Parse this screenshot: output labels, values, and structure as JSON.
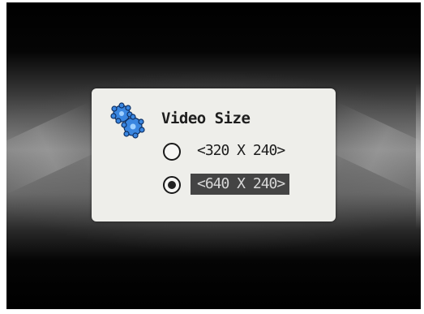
{
  "dialog": {
    "title": "Video Size",
    "options": [
      {
        "label": "<320 X 240>",
        "selected": false
      },
      {
        "label": "<640 X 240>",
        "selected": true
      }
    ]
  },
  "icons": {
    "settings": "gear-cluster-icon"
  },
  "colors": {
    "dialog_background": "#eeeeea",
    "icon_blue": "#3a86e0",
    "highlight_background": "#444444"
  }
}
